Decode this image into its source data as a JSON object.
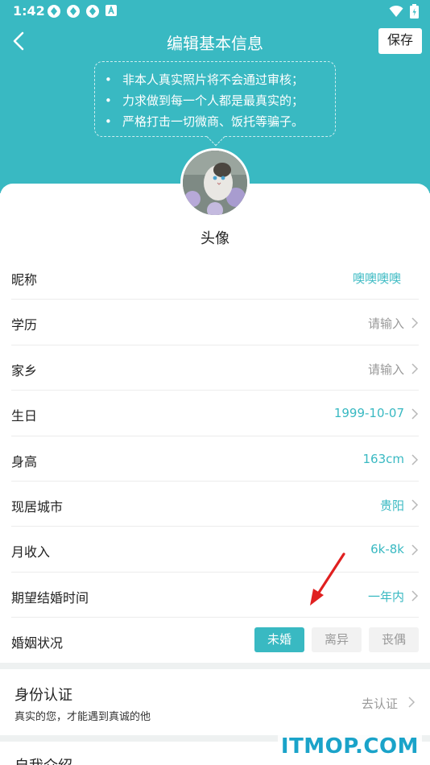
{
  "status_bar": {
    "time": "1:42"
  },
  "nav": {
    "title": "编辑基本信息",
    "save_label": "保存"
  },
  "notice": [
    "非本人真实照片将不会通过审核；",
    "力求做到每一个人都是最真实的；",
    "严格打击一切微商、饭托等骗子。"
  ],
  "avatar": {
    "label": "头像"
  },
  "fields": {
    "nickname": {
      "label": "昵称",
      "value": "噢噢噢噢"
    },
    "education": {
      "label": "学历",
      "value": "请输入"
    },
    "hometown": {
      "label": "家乡",
      "value": "请输入"
    },
    "birthday": {
      "label": "生日",
      "value": "1999-10-07"
    },
    "height": {
      "label": "身高",
      "value": "163cm"
    },
    "city": {
      "label": "现居城市",
      "value": "贵阳"
    },
    "income": {
      "label": "月收入",
      "value": "6k-8k"
    },
    "marriage_time": {
      "label": "期望结婚时间",
      "value": "一年内"
    },
    "marital_status": {
      "label": "婚姻状况",
      "options": [
        "未婚",
        "离异",
        "丧偶"
      ],
      "selected": "未婚"
    }
  },
  "identity": {
    "title": "身份认证",
    "subtitle": "真实的您，才能遇到真诚的他",
    "action": "去认证"
  },
  "intro": {
    "title": "自我介绍"
  },
  "watermark": "ITMOP.COM",
  "colors": {
    "accent": "#39b9c2",
    "placeholder": "#999999",
    "annotation_arrow": "#e02020"
  },
  "icons": [
    "back-arrow-icon",
    "chevron-right-icon",
    "wifi-icon",
    "battery-icon",
    "notification-icon"
  ]
}
